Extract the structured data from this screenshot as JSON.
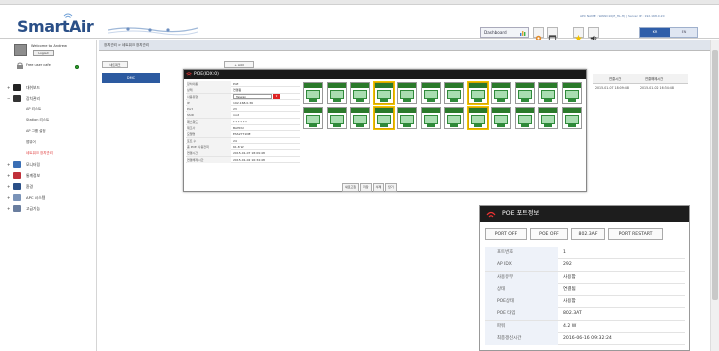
{
  "app": {
    "logo_text": "SmartAi",
    "logo_suffix": "r"
  },
  "header": {
    "apc_info": "APC NAME : WAWC10(E_HL-H) | Server IP : 192.168.0.20",
    "dashboard_label": "Dashboard",
    "lang_ko": "KR",
    "lang_en": "EN"
  },
  "sidebar": {
    "welcome": "Welcome to Andrew",
    "logout": "Logout",
    "user_status": "Free user cafe",
    "nav": [
      {
        "label": "대쉬보드",
        "color": "#222222"
      },
      {
        "label": "장치관리",
        "color": "#333333"
      }
    ],
    "sub_items": [
      {
        "label": "AP 리스트",
        "active": false
      },
      {
        "label": "Station 리스트",
        "active": false
      },
      {
        "label": "AP 그룹 설정",
        "active": false
      },
      {
        "label": "맵뷰어",
        "active": false
      },
      {
        "label": "네트워크 장치관리",
        "active": true
      }
    ],
    "nav2": [
      {
        "label": "모니터링",
        "color": "#3a6fb5"
      },
      {
        "label": "통계정보",
        "color": "#c0303a"
      },
      {
        "label": "환경",
        "color": "#2a4f87"
      },
      {
        "label": "APC 시스템",
        "color": "#7a93b8"
      },
      {
        "label": "고급기능",
        "color": "#6a7e9f"
      }
    ]
  },
  "breadcrumb": "장치관리 > 네트워크 장치관리",
  "main": {
    "home_tab": "네트워크",
    "dmc_label": "DMC",
    "add_tab": "+ Add",
    "time_header": [
      "연결시간",
      "연결해제시간"
    ],
    "time_row": [
      "2015-01-07 18:09:48",
      "2015-01-02 16:34:48"
    ]
  },
  "poe_window": {
    "title": "POE(IDX:0)",
    "form": [
      {
        "k": "장치이름",
        "v": "PoE"
      },
      {
        "k": "상태",
        "v": "연결됨"
      },
      {
        "k": "사용유형",
        "v": "Taiwan",
        "select": true
      },
      {
        "k": "IP",
        "v": "192.168.0.36"
      },
      {
        "k": "Port",
        "v": "23"
      },
      {
        "k": "SSID",
        "v": "root"
      },
      {
        "k": "패스워드",
        "v": "* * * * * *"
      },
      {
        "k": "제조사",
        "v": "BAHDU"
      },
      {
        "k": "모델명",
        "v": "ESS2771NE"
      },
      {
        "k": "포트 수",
        "v": "24"
      },
      {
        "k": "총 POE 사용전력",
        "v": "61.8 W"
      },
      {
        "k": "연결시간",
        "v": "2015-01-07 18:09:48"
      },
      {
        "k": "연결해제시간",
        "v": "2015-01-02 16:34:48"
      }
    ],
    "select_badge": "▾",
    "buttons": [
      "새로고침",
      "저장",
      "삭제",
      "닫기"
    ],
    "port_count": 24,
    "highlighted_ports": [
      4,
      8,
      16,
      20
    ]
  },
  "port_panel": {
    "title": "POE 포트정보",
    "buttons": [
      "PORT OFF",
      "POE OFF",
      "802.3AF",
      "PORT RESTART"
    ],
    "rows": [
      {
        "k": "포트번호",
        "v": "1"
      },
      {
        "k": "AP IDX",
        "v": "292"
      },
      {
        "k": "사용유무",
        "v": "사용함"
      },
      {
        "k": "상태",
        "v": "연결됨"
      },
      {
        "k": "POE상태",
        "v": "사용함"
      },
      {
        "k": "POE 타입",
        "v": "802.3AT"
      },
      {
        "k": "파워",
        "v": "4.2 W"
      },
      {
        "k": "최종갱신시간",
        "v": "2016-06-16 09:32:24"
      }
    ]
  },
  "colors": {
    "accent": "#2c5aa0",
    "header_bar": "#1a1a1a",
    "port_green": "#2f8a3a",
    "highlight": "#f0c400"
  }
}
